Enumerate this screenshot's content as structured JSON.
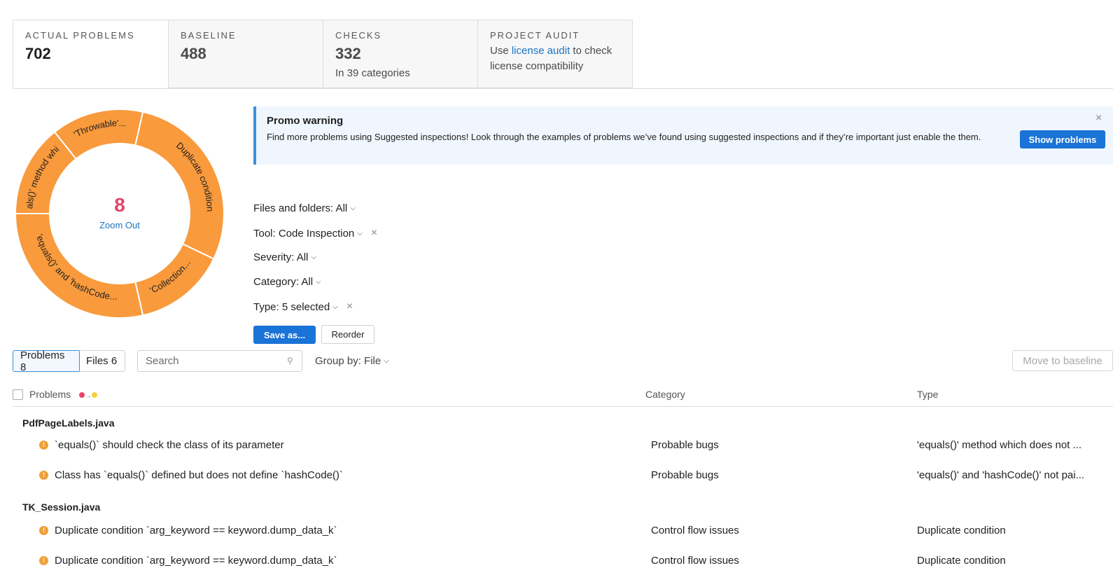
{
  "tabs": [
    {
      "label": "ACTUAL PROBLEMS",
      "value": "702"
    },
    {
      "label": "BASELINE",
      "value": "488"
    },
    {
      "label": "CHECKS",
      "value": "332",
      "sub": "In 39 categories"
    },
    {
      "label": "PROJECT AUDIT",
      "text_before": "Use ",
      "link": "license audit",
      "text_after": " to check license compatibility"
    }
  ],
  "donut": {
    "center_value": "8",
    "center_link": "Zoom Out",
    "color": "#f99a3c",
    "segments": [
      {
        "label": "'equals()' method which ...",
        "value": 1
      },
      {
        "label": "'Throwable'...",
        "value": 1
      },
      {
        "label": "Duplicate condition",
        "value": 2
      },
      {
        "label": "'Collection...",
        "value": 1
      },
      {
        "label": "'equals()' and 'hashCode...",
        "value": 2
      }
    ]
  },
  "promo": {
    "title": "Promo warning",
    "text": "Find more problems using Suggested inspections! Look through the examples of problems we’ve found using suggested inspections and if they’re important just enable the them.",
    "button": "Show problems",
    "close_icon": "×"
  },
  "filters": {
    "files": "Files and folders: All",
    "tool": "Tool: Code Inspection",
    "severity": "Severity: All",
    "category": "Category: All",
    "type": "Type: 5 selected"
  },
  "actions": {
    "save": "Save as...",
    "reorder": "Reorder"
  },
  "toolbar": {
    "problems_tab": "Problems 8",
    "files_tab": "Files 6",
    "search_placeholder": "Search",
    "group_by": "Group by: File",
    "move_to_baseline": "Move to baseline"
  },
  "table": {
    "headers": {
      "problems": "Problems",
      "category": "Category",
      "type": "Type"
    },
    "severity_colors": [
      "#e8436c",
      "#f5cf3e"
    ],
    "groups": [
      {
        "file": "PdfPageLabels.java",
        "rows": [
          {
            "problem": "`equals()` should check the class of its parameter",
            "category": "Probable bugs",
            "type": "'equals()' method which does not ..."
          },
          {
            "problem": "Class has `equals()` defined but does not define `hashCode()`",
            "category": "Probable bugs",
            "type": "'equals()' and 'hashCode()' not pai..."
          }
        ]
      },
      {
        "file": "TK_Session.java",
        "rows": [
          {
            "problem": "Duplicate condition `arg_keyword == keyword.dump_data_k`",
            "category": "Control flow issues",
            "type": "Duplicate condition"
          },
          {
            "problem": "Duplicate condition `arg_keyword == keyword.dump_data_k`",
            "category": "Control flow issues",
            "type": "Duplicate condition"
          }
        ]
      }
    ]
  }
}
